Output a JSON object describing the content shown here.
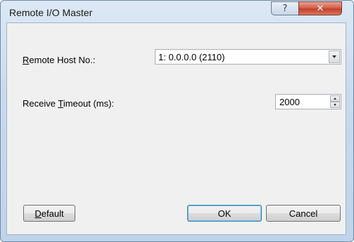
{
  "window": {
    "title": "Remote I/O Master",
    "help_glyph": "?",
    "close_glyph": "✕"
  },
  "fields": {
    "remote_host": {
      "label_prefix": "",
      "label_mnemonic": "R",
      "label_suffix": "emote Host No.:",
      "value": "1: 0.0.0.0 (2110)"
    },
    "receive_timeout": {
      "label_prefix": "Receive ",
      "label_mnemonic": "T",
      "label_suffix": "imeout (ms):",
      "value": "2000"
    }
  },
  "buttons": {
    "default": {
      "mnemonic": "D",
      "rest": "efault"
    },
    "ok": "OK",
    "cancel": "Cancel"
  }
}
